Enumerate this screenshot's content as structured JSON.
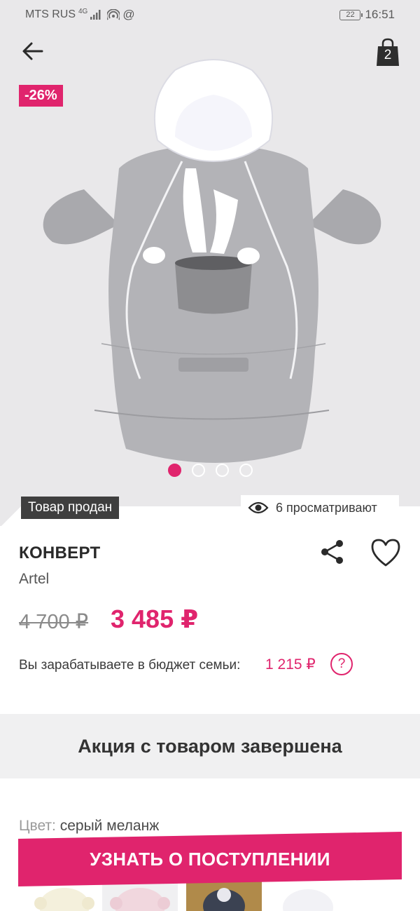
{
  "statusbar": {
    "carrier": "MTS RUS",
    "network": "4G",
    "battery": "22",
    "time": "16:51"
  },
  "header": {
    "bag_count": "2"
  },
  "gallery": {
    "discount_badge": "-26%",
    "slide_count": 4,
    "active_slide": 1,
    "sold_label": "Товар продан",
    "views_label": "6 просматривают"
  },
  "product": {
    "title": "КОНВЕРТ",
    "brand": "Artel",
    "old_price": "4 700 ₽",
    "new_price": "3 485 ₽",
    "earn_label": "Вы зарабатываете в бюджет семьи:",
    "earn_value": "1 215 ₽",
    "help_label": "?"
  },
  "promo": {
    "text": "Акция с товаром завершена"
  },
  "color": {
    "label": "Цвет:",
    "value": "серый меланж"
  },
  "cta": {
    "label": "УЗНАТЬ О ПОСТУПЛЕНИИ"
  },
  "colors": {
    "accent": "#e0246d",
    "hero_bg": "#e9e8ea",
    "promo_bg": "#f0f0f1"
  }
}
